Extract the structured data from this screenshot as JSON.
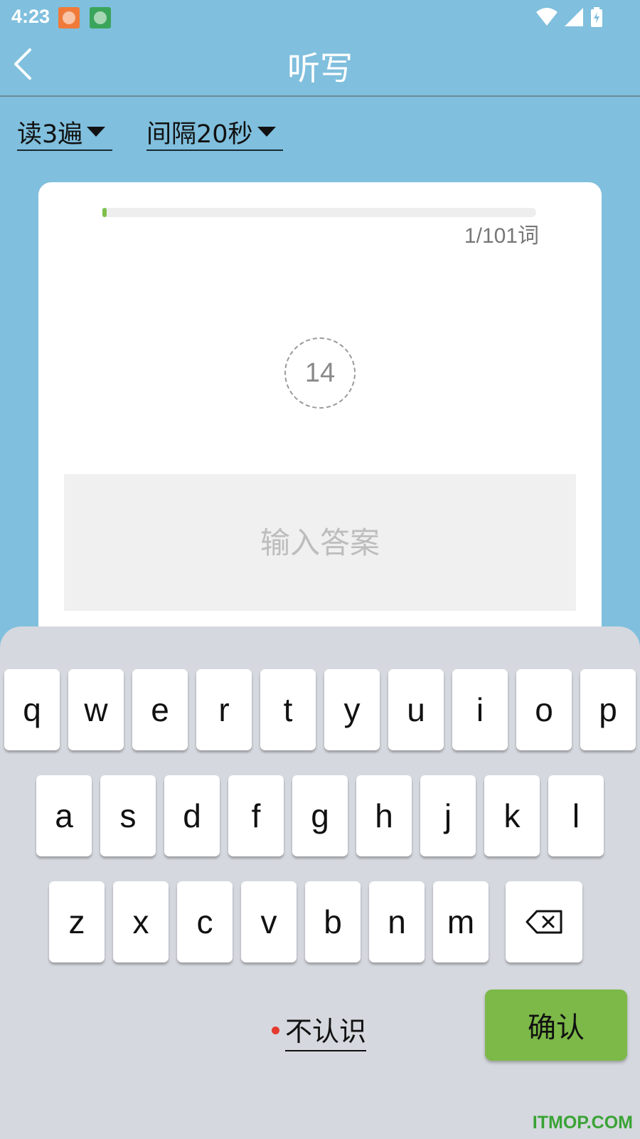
{
  "status_bar": {
    "time": "4:23",
    "icons": [
      "app-notification-icon",
      "app-notification-icon",
      "wifi-icon",
      "cellular-signal-icon",
      "battery-charging-icon"
    ]
  },
  "header": {
    "title": "听写",
    "back_icon": "back-arrow-icon"
  },
  "settings": {
    "repeat": {
      "label": "读3遍"
    },
    "interval": {
      "label": "间隔20秒"
    }
  },
  "progress": {
    "current": 1,
    "total": 101,
    "fraction": 0.0099,
    "label": "1/101词"
  },
  "countdown": {
    "value": "14"
  },
  "answer": {
    "value": "",
    "placeholder": "输入答案"
  },
  "keyboard": {
    "row1": [
      "q",
      "w",
      "e",
      "r",
      "t",
      "y",
      "u",
      "i",
      "o",
      "p"
    ],
    "row2": [
      "a",
      "s",
      "d",
      "f",
      "g",
      "h",
      "j",
      "k",
      "l"
    ],
    "row3": [
      "z",
      "x",
      "c",
      "v",
      "b",
      "n",
      "m"
    ],
    "backspace_icon": "backspace-icon"
  },
  "actions": {
    "unknown_label": "不认识",
    "confirm_label": "确认"
  },
  "watermark": "ITMOP.COM",
  "colors": {
    "background": "#80bfdd",
    "accent_green": "#7cb948",
    "progress_green": "#7cbf4a",
    "keyboard_bg": "#d5d8de",
    "dot_red": "#e53b2f"
  }
}
